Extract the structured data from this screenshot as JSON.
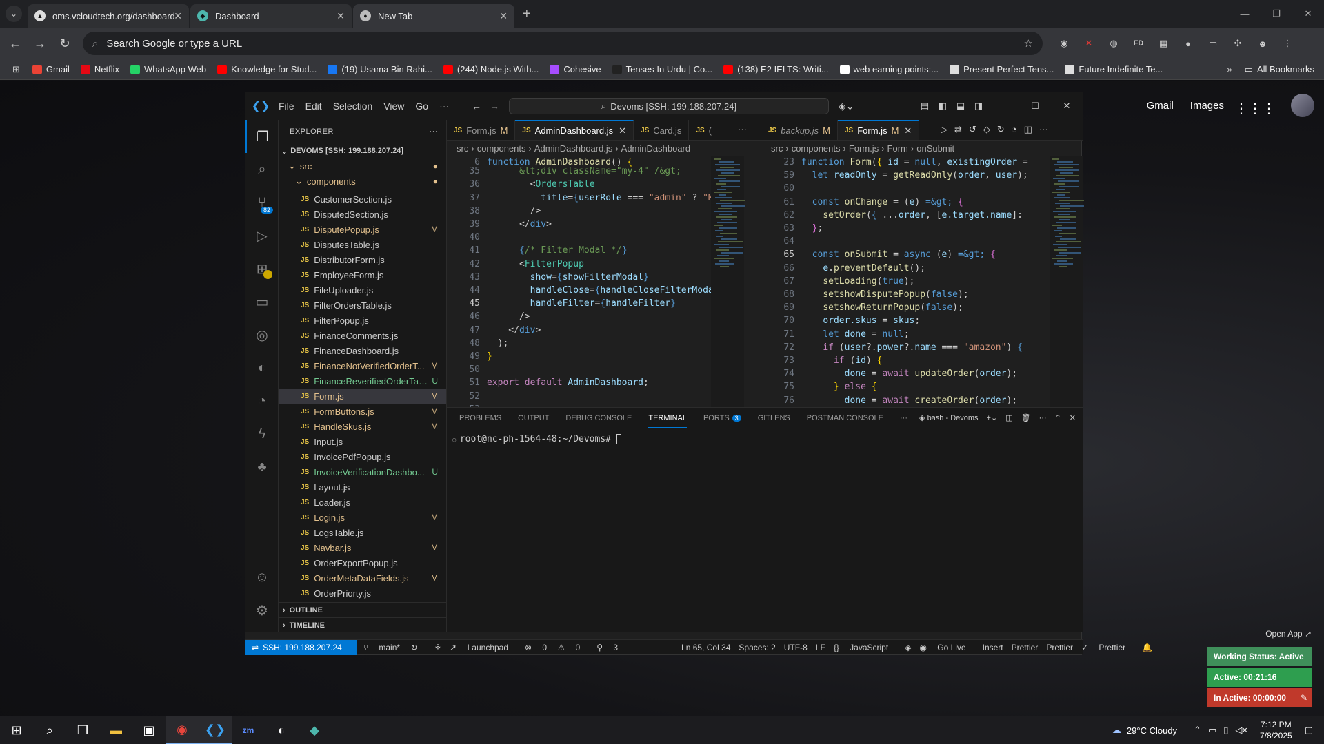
{
  "chrome": {
    "tabs": [
      {
        "title": "oms.vcloudtech.org/dashboard",
        "active": false
      },
      {
        "title": "Dashboard",
        "active": false
      },
      {
        "title": "New Tab",
        "active": true
      }
    ],
    "omnibox_placeholder": "Search Google or type a URL",
    "bookmarks": [
      {
        "label": "Gmail",
        "color": "#ea4335"
      },
      {
        "label": "Netflix",
        "color": "#e50914"
      },
      {
        "label": "WhatsApp Web",
        "color": "#25d366"
      },
      {
        "label": "Knowledge for Stud...",
        "color": "#ff0000"
      },
      {
        "label": "(19) Usama Bin Rahi...",
        "color": "#1877f2"
      },
      {
        "label": "(244) Node.js With...",
        "color": "#ff0000"
      },
      {
        "label": "Cohesive",
        "color": "#a64dff"
      },
      {
        "label": "Tenses In Urdu | Co...",
        "color": "#222222"
      },
      {
        "label": "(138) E2 IELTS: Writi...",
        "color": "#ff0000"
      },
      {
        "label": "web earning points:...",
        "color": "#ffffff"
      },
      {
        "label": "Present Perfect Tens...",
        "color": "#dddddd"
      },
      {
        "label": "Future Indefinite Te...",
        "color": "#dddddd"
      }
    ],
    "all_bookmarks": "All Bookmarks"
  },
  "google": {
    "gmail": "Gmail",
    "images": "Images"
  },
  "vscode": {
    "menu": [
      "File",
      "Edit",
      "Selection",
      "View",
      "Go",
      "···"
    ],
    "command_center": "Devoms [SSH: 199.188.207.24]",
    "explorer": {
      "title": "EXPLORER",
      "root": "DEVOMS [SSH: 199.188.207.24]",
      "src": "src",
      "components": "components",
      "files": [
        {
          "name": "CustomerSection.js",
          "status": ""
        },
        {
          "name": "DisputedSection.js",
          "status": ""
        },
        {
          "name": "DisputePopup.js",
          "status": "M"
        },
        {
          "name": "DisputesTable.js",
          "status": ""
        },
        {
          "name": "DistributorForm.js",
          "status": ""
        },
        {
          "name": "EmployeeForm.js",
          "status": ""
        },
        {
          "name": "FileUploader.js",
          "status": ""
        },
        {
          "name": "FilterOrdersTable.js",
          "status": ""
        },
        {
          "name": "FilterPopup.js",
          "status": ""
        },
        {
          "name": "FinanceComments.js",
          "status": ""
        },
        {
          "name": "FinanceDashboard.js",
          "status": ""
        },
        {
          "name": "FinanceNotVerifiedOrderT...",
          "status": "M"
        },
        {
          "name": "FinanceReverifiedOrderTab...",
          "status": "U"
        },
        {
          "name": "Form.js",
          "status": "M"
        },
        {
          "name": "FormButtons.js",
          "status": "M"
        },
        {
          "name": "HandleSkus.js",
          "status": "M"
        },
        {
          "name": "Input.js",
          "status": ""
        },
        {
          "name": "InvoicePdfPopup.js",
          "status": ""
        },
        {
          "name": "InvoiceVerificationDashbo...",
          "status": "U"
        },
        {
          "name": "Layout.js",
          "status": ""
        },
        {
          "name": "Loader.js",
          "status": ""
        },
        {
          "name": "Login.js",
          "status": "M"
        },
        {
          "name": "LogsTable.js",
          "status": ""
        },
        {
          "name": "Navbar.js",
          "status": "M"
        },
        {
          "name": "OrderExportPopup.js",
          "status": ""
        },
        {
          "name": "OrderMetaDataFields.js",
          "status": "M"
        },
        {
          "name": "OrderPriorty.js",
          "status": ""
        }
      ],
      "outline": "OUTLINE",
      "timeline": "TIMELINE"
    },
    "scm_badge": "82",
    "left_tabs": [
      {
        "label": "Form.js",
        "mod": "M",
        "active": false
      },
      {
        "label": "AdminDashboard.js",
        "mod": "",
        "active": true
      },
      {
        "label": "Card.js",
        "mod": "",
        "active": false
      },
      {
        "label": "(",
        "mod": "",
        "active": false
      }
    ],
    "right_tabs": [
      {
        "label": "backup.js",
        "mod": "M",
        "active": false
      },
      {
        "label": "Form.js",
        "mod": "M",
        "active": true
      }
    ],
    "left_breadcrumb": [
      "src",
      "components",
      "AdminDashboard.js",
      "AdminDashboard"
    ],
    "right_breadcrumb": [
      "src",
      "components",
      "Form.js",
      "Form",
      "onSubmit"
    ],
    "left_lines": [
      "6",
      "35",
      "36",
      "37",
      "38",
      "39",
      "40",
      "41",
      "42",
      "43",
      "44",
      "45",
      "46",
      "47",
      "48",
      "49",
      "50",
      "51",
      "52",
      "53"
    ],
    "right_lines": [
      "23",
      "59",
      "60",
      "61",
      "62",
      "63",
      "64",
      "65",
      "66",
      "67",
      "68",
      "69",
      "70",
      "71",
      "72",
      "73",
      "74",
      "75",
      "76"
    ],
    "panel_tabs": [
      "PROBLEMS",
      "OUTPUT",
      "DEBUG CONSOLE",
      "TERMINAL",
      "PORTS",
      "GITLENS",
      "POSTMAN CONSOLE"
    ],
    "ports_badge": "3",
    "terminal_name": "bash - Devoms",
    "prompt": "root@nc-ph-1564-48:~/Devoms#",
    "status": {
      "remote": "SSH: 199.188.207.24",
      "branch": "main*",
      "launchpad": "Launchpad",
      "problems": "0",
      "warnings": "0",
      "ports": "3",
      "position": "Ln 65, Col 34",
      "spaces": "Spaces: 2",
      "encoding": "UTF-8",
      "eol": "LF",
      "language": "JavaScript",
      "golive": "Go Live",
      "insert": "Insert",
      "prettier1": "Prettier",
      "prettier2": "Prettier",
      "prettier3": "Prettier"
    }
  },
  "widget": {
    "open_app": "Open App",
    "working": "Working Status: Active",
    "active": "Active: 00:21:16",
    "inactive": "In Active: 00:00:00"
  },
  "taskbar": {
    "weather": "29°C  Cloudy",
    "time": "7:12 PM",
    "date": "7/8/2025"
  }
}
